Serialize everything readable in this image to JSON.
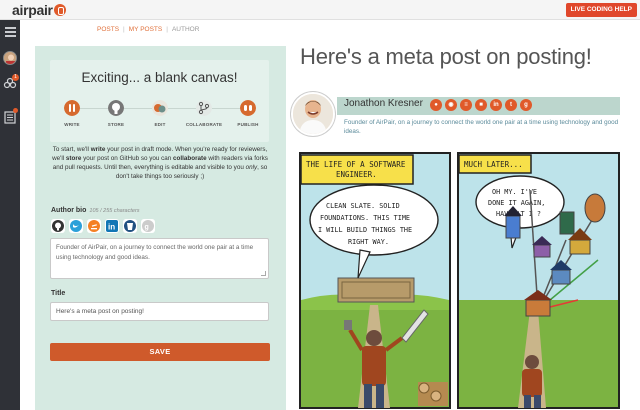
{
  "app": {
    "logo_text": "airpair",
    "live_button": "LIVE CODING HELP"
  },
  "sidebar": {
    "badge_count": "1"
  },
  "breadcrumb": {
    "items": [
      "POSTS",
      "MY POSTS",
      "AUTHOR"
    ]
  },
  "canvas": {
    "heading": "Exciting... a blank canvas!",
    "steps": [
      {
        "label": "WRITE",
        "icon": "write-icon"
      },
      {
        "label": "STORE",
        "icon": "github-icon"
      },
      {
        "label": "EDIT",
        "icon": "edit-icon"
      },
      {
        "label": "COLLABORATE",
        "icon": "branch-icon"
      },
      {
        "label": "PUBLISH",
        "icon": "publish-icon"
      }
    ]
  },
  "intro": {
    "p1": "To start, we'll ",
    "b1": "write",
    "p2": " your post in draft mode. When you're ready for reviewers, we'll ",
    "b2": "store",
    "p3": " your post on GitHub so you can ",
    "b3": "collaborate",
    "p4": " with readers via forks and pull requests. Until then, everything is editable and visible to you ",
    "i1": "only",
    "p5": ", so don't take things too seriously ;)"
  },
  "form": {
    "bio_label": "Author bio",
    "bio_count": "105 / 255 characters",
    "bio_value": "Founder of AirPair, on a journey to connect the world one pair at a time using technology and good ideas.",
    "title_label": "Title",
    "title_value": "Here's a meta post on posting!",
    "save_label": "SAVE"
  },
  "post": {
    "title": "Here's a meta post on posting!",
    "author_name": "Jonathon Kresner",
    "author_bio": "Founder of AirPair, on a journey to connect the world one pair at a time using technology and good ideas."
  },
  "comic": {
    "panel1_caption": "THE LIFE OF A SOFTWARE ENGINEER.",
    "panel1_speech": "CLEAN SLATE. SOLID FOUNDATIONS. THIS TIME I WILL BUILD THINGS THE RIGHT WAY.",
    "panel2_caption": "MUCH LATER...",
    "panel2_speech": "OH MY. I'VE DONE IT AGAIN, HAVEN'T I ?"
  },
  "colors": {
    "accent": "#e05a2a",
    "panel_bg": "#d6eae2",
    "author_bar": "#bcd6cd",
    "sidebar": "#2f3137"
  }
}
